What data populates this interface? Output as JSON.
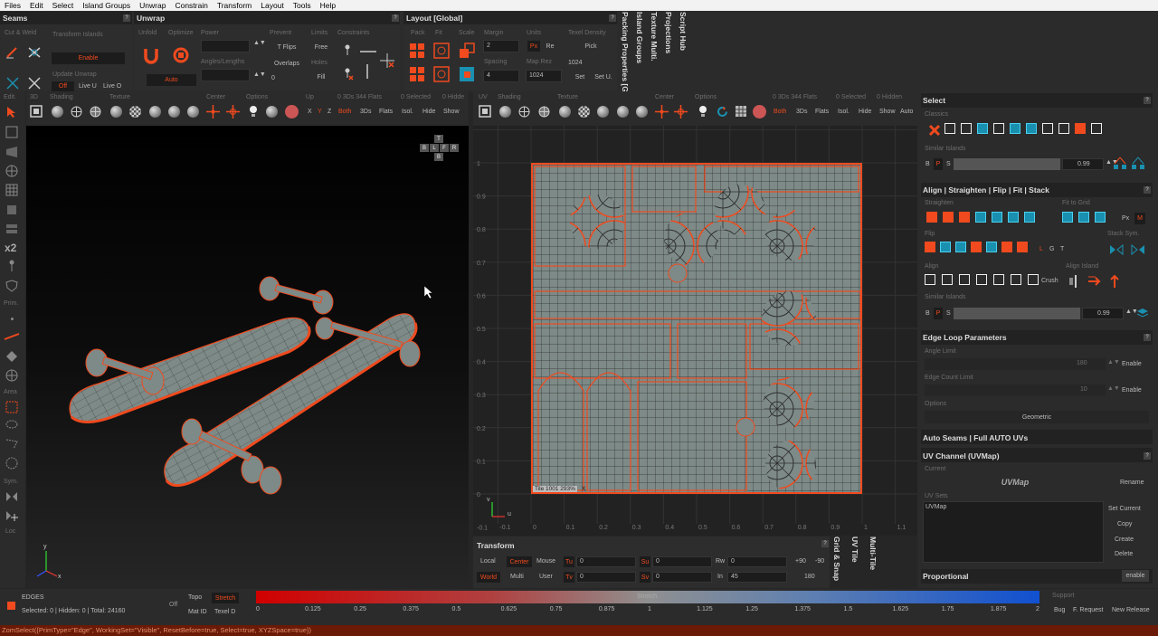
{
  "menu": [
    "Files",
    "Edit",
    "Select",
    "Island Groups",
    "Unwrap",
    "Constrain",
    "Transform",
    "Layout",
    "Tools",
    "Help"
  ],
  "seams": {
    "title": "Seams",
    "cut_weld": "Cut & Weld",
    "transform_islands": "Transform Islands",
    "enable": "Enable",
    "update_unwrap": "Update Unwrap",
    "off": "Off",
    "live_u": "Live U",
    "live_o": "Live O"
  },
  "unwrap": {
    "title": "Unwrap",
    "unfold": "Unfold",
    "optimize": "Optimize",
    "power": "Power",
    "prevent": "Prevent",
    "limits": "Limits",
    "constraints": "Constraints",
    "t_flips": "T Flips",
    "free": "Free",
    "angles_lengths": "Angles/Lengths",
    "overlaps": "Overlaps",
    "holes": "Holes",
    "fill": "Fill",
    "auto": "Auto",
    "zero": "0"
  },
  "layout": {
    "title": "Layout [Global]",
    "pack": "Pack",
    "fit": "Fit",
    "scale": "Scale",
    "margin": "Margin",
    "units": "Units",
    "texel_density": "Texel Density",
    "margin_val": "2",
    "px": "Px",
    "re": "Re",
    "pick": "Pick",
    "spacing": "Spacing",
    "map_rez": "Map Rez",
    "map_rez_val": "1024",
    "spacing_val": "4",
    "map_rez_val2": "1024",
    "set": "Set",
    "set_u": "Set U."
  },
  "vtabs": [
    "Packing Properties [G",
    "Island Groups",
    "Texture Multi.",
    "Projections",
    "Script Hub"
  ],
  "left_tools": {
    "edit": "Edit.",
    "x2": "x2",
    "prim": "Prim.",
    "area": "Area",
    "sym": "Sym.",
    "loc": "Loc"
  },
  "vp3d": {
    "tab": "3D",
    "shading": "Shading",
    "texture": "Texture",
    "center": "Center",
    "options": "Options",
    "up": "Up",
    "x": "X",
    "y": "Y",
    "z": "Z",
    "both": "Both",
    "threeds": "3Ds",
    "flats": "Flats",
    "isol": "Isol.",
    "hide": "Hide",
    "show": "Show",
    "stats": "0 3Ds 344 Flats",
    "selected": "0 Selected",
    "hidden": "0 Hidde",
    "cube_t": "T",
    "cube_b": "B",
    "cube_l": "L",
    "cube_f": "F",
    "cube_r": "R",
    "cube_bk": "B"
  },
  "vpuv": {
    "tab": "UV",
    "shading": "Shading",
    "texture": "Texture",
    "center": "Center",
    "options": "Options",
    "both": "Both",
    "threeds": "3Ds",
    "flats": "Flats",
    "isol": "Isol.",
    "hide": "Hide",
    "show": "Show",
    "auto": "Auto",
    "stats": "0 3Ds 344 Flats",
    "selected": "0 Selected",
    "hidden": "0 Hidden",
    "tile": "Tile 1001 293%",
    "xk": "X",
    "axis_v": "v",
    "axis_u": "u"
  },
  "uv_ticks_x": [
    "-0.1",
    "0",
    "0.1",
    "0.2",
    "0.3",
    "0.4",
    "0.5",
    "0.6",
    "0.7",
    "0.8",
    "0.9",
    "1",
    "1.1"
  ],
  "uv_ticks_y": [
    "1",
    "0.9",
    "0.8",
    "0.7",
    "0.6",
    "0.5",
    "0.4",
    "0.3",
    "0.2",
    "0.1",
    "0",
    "-0.1"
  ],
  "transform": {
    "title": "Transform",
    "local": "Local",
    "center": "Center",
    "mouse": "Mouse",
    "world": "World",
    "multi": "Multi",
    "user": "User",
    "tu": "Tu",
    "tv": "Tv",
    "su": "Su",
    "sv": "Sv",
    "rw": "Rw",
    "in": "In",
    "in_val": "45",
    "plus90": "+90",
    "minus90": "-90",
    "v180": "180",
    "zero": "0"
  },
  "right_vtabs": [
    "Grid & Snap",
    "UV Tile",
    "Multi-Tile"
  ],
  "select": {
    "title": "Select",
    "classics": "Classics",
    "similar": "Similar Islands",
    "b": "B",
    "p": "P",
    "s": "S",
    "val": "0.99"
  },
  "align": {
    "title": "Align | Straighten | Flip | Fit | Stack",
    "straighten": "Straighten",
    "fit_grid": "Fit to Grid",
    "px": "Px",
    "m": "M",
    "flip": "Flip",
    "stack_sym": "Stack Sym.",
    "l": "L",
    "g": "G",
    "t": "T",
    "align": "Align",
    "align_island": "Align Island",
    "crush": "Crush",
    "similar": "Similar Islands",
    "b": "B",
    "p": "P",
    "s": "S",
    "val": "0.99"
  },
  "edge_loop": {
    "title": "Edge Loop Parameters",
    "angle_limit": "Angle Limit",
    "angle_val": "180",
    "enable": "Enable",
    "edge_count": "Edge Count Limit",
    "count_val": "10",
    "options": "Options",
    "geometric": "Geometric"
  },
  "auto_seams": {
    "title": "Auto Seams | Full AUTO UVs"
  },
  "uv_channel": {
    "title": "UV Channel (UVMap)",
    "current": "Current",
    "uvmap": "UVMap",
    "rename": "Rename",
    "uv_sets": "UV Sets",
    "set_item": "UVMap",
    "set_current": "Set Current",
    "copy": "Copy",
    "create": "Create",
    "delete": "Delete"
  },
  "proportional": {
    "title": "Proportional",
    "enable": "enable"
  },
  "status": {
    "mode": "EDGES",
    "counts": "Selected: 0 | Hidden: 0 | Total: 24160",
    "off": "Off",
    "topo": "Topo",
    "stretch": "Stretch",
    "mat_id": "Mat ID",
    "texel_d": "Texel D",
    "stretch_lbl": "Stretch",
    "support": "Support",
    "bug": "Bug",
    "freq": "F. Request",
    "new_release": "New Release"
  },
  "stretch_ticks": [
    "0",
    "0.125",
    "0.25",
    "0.375",
    "0.5",
    "0.625",
    "0.75",
    "0.875",
    "1",
    "1.125",
    "1.25",
    "1.375",
    "1.5",
    "1.625",
    "1.75",
    "1.875",
    "2"
  ],
  "command": "ZomSelect({PrimType=\"Edge\", WorkingSet=\"Visible\", ResetBefore=true, Select=true, XYZSpace=true})",
  "colors": {
    "accent": "#f04a1e",
    "cyan": "#1a90b0",
    "mesh": "#7d8a87"
  }
}
